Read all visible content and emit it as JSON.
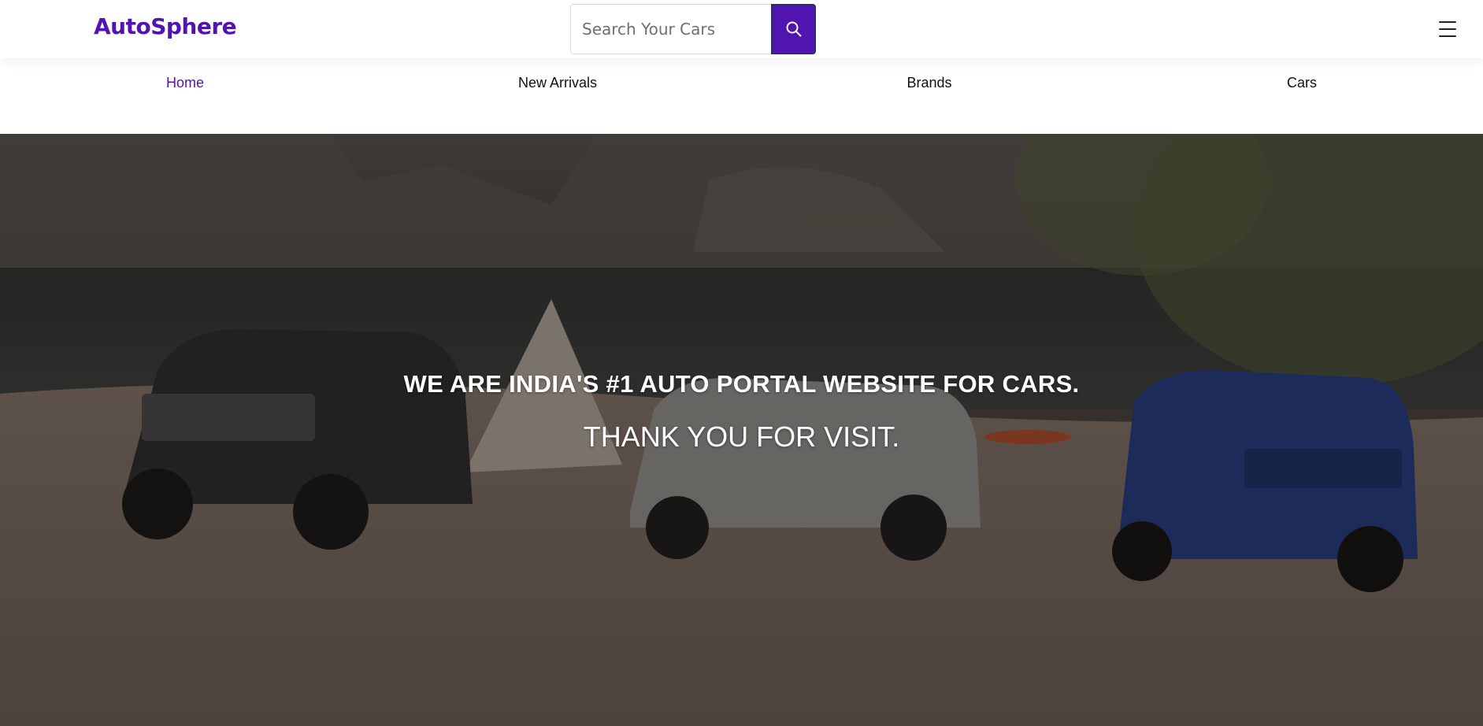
{
  "brand": {
    "logo": "AutoSphere",
    "accent_color": "#5214b0"
  },
  "search": {
    "placeholder": "Search Your Cars",
    "button_icon": "search-icon"
  },
  "menu": {
    "icon": "hamburger-menu-icon"
  },
  "nav": {
    "items": [
      {
        "label": "Home",
        "active": true
      },
      {
        "label": "New Arrivals",
        "active": false
      },
      {
        "label": "Brands",
        "active": false
      },
      {
        "label": "Cars",
        "active": false
      }
    ]
  },
  "hero": {
    "title": "WE ARE INDIA'S #1 AUTO PORTAL WEBSITE FOR CARS.",
    "subtitle": "THANK YOU FOR VISIT."
  }
}
